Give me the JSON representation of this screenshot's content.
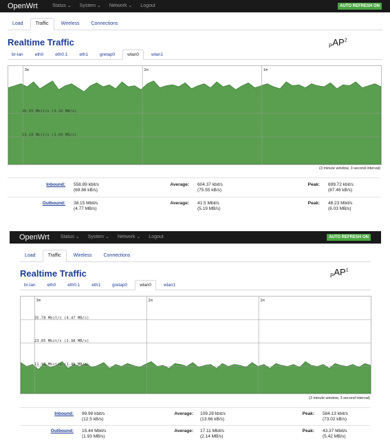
{
  "panels": [
    {
      "brand": "OpenWrt",
      "menu": [
        "Status ⌄",
        "System ⌄",
        "Network ⌄",
        "Logout"
      ],
      "auto_refresh": "AUTO REFRESH ON",
      "tabs": [
        {
          "label": "Load",
          "active": false
        },
        {
          "label": "Traffic",
          "active": true
        },
        {
          "label": "Wireless",
          "active": false
        },
        {
          "label": "Connections",
          "active": false
        }
      ],
      "title": "Realtime Traffic",
      "ap_label": {
        "p": "P",
        "main": "AP",
        "sup": "2"
      },
      "interfaces": [
        {
          "label": "br-lan",
          "active": false
        },
        {
          "label": "eth0",
          "active": false
        },
        {
          "label": "eth0.1",
          "active": false
        },
        {
          "label": "eth1",
          "active": false
        },
        {
          "label": "gretap0",
          "active": false
        },
        {
          "label": "wlan0",
          "active": true
        },
        {
          "label": "wlan1",
          "active": false
        }
      ],
      "graph": {
        "time_labels": [
          "3m",
          "2m",
          "1m"
        ],
        "scale_labels": [
          "26.55 Mbit/s (3.32 MB/s)",
          "13.28 Mbit/s (1.66 MB/s)"
        ],
        "fill_color": "#5a9e4f",
        "traffic_levels": [
          0.78,
          0.8,
          0.82,
          0.79,
          0.84,
          0.77,
          0.81,
          0.85,
          0.76,
          0.8,
          0.82,
          0.78,
          0.74,
          0.8,
          0.83,
          0.79,
          0.81,
          0.77,
          0.84,
          0.79,
          0.8,
          0.76,
          0.82,
          0.85,
          0.78,
          0.8,
          0.81,
          0.79,
          0.83,
          0.77,
          0.8,
          0.82,
          0.78,
          0.84,
          0.79,
          0.81,
          0.76,
          0.8,
          0.83,
          0.78,
          0.8,
          0.82,
          0.79,
          0.77,
          0.84,
          0.8,
          0.81,
          0.78,
          0.82,
          0.8,
          0.79,
          0.83,
          0.77,
          0.81,
          0.8,
          0.84,
          0.78,
          0.8,
          0.82,
          0.79
        ]
      },
      "window_note": "(3 minute window, 3 second interval)",
      "stats": [
        {
          "label": "Inbound:",
          "value": "558.89 kbit/s",
          "value2": "(69.86 kB/s)",
          "avg_label": "Average:",
          "avg": "604.37 kbit/s",
          "avg2": "(75.55 kB/s)",
          "peak_label": "Peak:",
          "peak": "699.72 kbit/s",
          "peak2": "(87.46 kB/s)"
        },
        {
          "label": "Outbound:",
          "value": "38.15 Mbit/s",
          "value2": "(4.77 MB/s)",
          "avg_label": "Average:",
          "avg": "41.5 Mbit/s",
          "avg2": "(5.19 MB/s)",
          "peak_label": "Peak:",
          "peak": "48.23 Mbit/s",
          "peak2": "(6.03 MB/s)"
        }
      ]
    },
    {
      "brand": "OpenWrt",
      "menu": [
        "Status ⌄",
        "System ⌄",
        "Network ⌄",
        "Logout"
      ],
      "auto_refresh": "AUTO REFRESH ON",
      "tabs": [
        {
          "label": "Load",
          "active": false
        },
        {
          "label": "Traffic",
          "active": true
        },
        {
          "label": "Wireless",
          "active": false
        },
        {
          "label": "Connections",
          "active": false
        }
      ],
      "title": "Realtime Traffic",
      "ap_label": {
        "p": "P",
        "main": "AP",
        "sup": "1"
      },
      "interfaces": [
        {
          "label": "br-lan",
          "active": false
        },
        {
          "label": "eth0",
          "active": false
        },
        {
          "label": "eth0.1",
          "active": false
        },
        {
          "label": "eth1",
          "active": false
        },
        {
          "label": "gretap0",
          "active": false
        },
        {
          "label": "wlan0",
          "active": true
        },
        {
          "label": "wlan1",
          "active": false
        }
      ],
      "graph": {
        "time_labels": [
          "3m",
          "2m",
          "1m"
        ],
        "scale_labels": [
          "35.78 Mbit/s (4.47 MB/s)",
          "23.85 Mbit/s (2.98 MB/s)",
          "11.93 Mbit/s (1.49 MB/s)"
        ],
        "fill_color": "#5a9e4f",
        "traffic_levels": [
          0.32,
          0.28,
          0.3,
          0.25,
          0.31,
          0.27,
          0.29,
          0.33,
          0.26,
          0.3,
          0.28,
          0.31,
          0.27,
          0.29,
          0.32,
          0.26,
          0.3,
          0.28,
          0.31,
          0.29,
          0.27,
          0.3,
          0.33,
          0.28,
          0.29,
          0.26,
          0.31,
          0.3,
          0.28,
          0.32,
          0.27,
          0.29,
          0.3,
          0.26,
          0.31,
          0.28,
          0.3,
          0.29,
          0.27,
          0.32,
          0.28,
          0.3,
          0.26,
          0.31,
          0.29,
          0.28,
          0.3,
          0.27,
          0.33,
          0.29,
          0.28,
          0.3,
          0.26,
          0.31,
          0.29,
          0.28,
          0.3,
          0.27,
          0.31,
          0.29
        ]
      },
      "window_note": "(3 minute window, 3 second interval)",
      "stats": [
        {
          "label": "Inbound:",
          "value": "99.98 kbit/s",
          "value2": "(12.5 kB/s)",
          "avg_label": "Average:",
          "avg": "109.28 kbit/s",
          "avg2": "(13.66 kB/s)",
          "peak_label": "Peak:",
          "peak": "584.13 kbit/s",
          "peak2": "(73.02 kB/s)"
        },
        {
          "label": "Outbound:",
          "value": "15.44 Mbit/s",
          "value2": "(1.93 MB/s)",
          "avg_label": "Average:",
          "avg": "17.11 Mbit/s",
          "avg2": "(2.14 MB/s)",
          "peak_label": "Peak:",
          "peak": "43.37 Mbit/s",
          "peak2": "(5.42 MB/s)"
        }
      ]
    }
  ]
}
